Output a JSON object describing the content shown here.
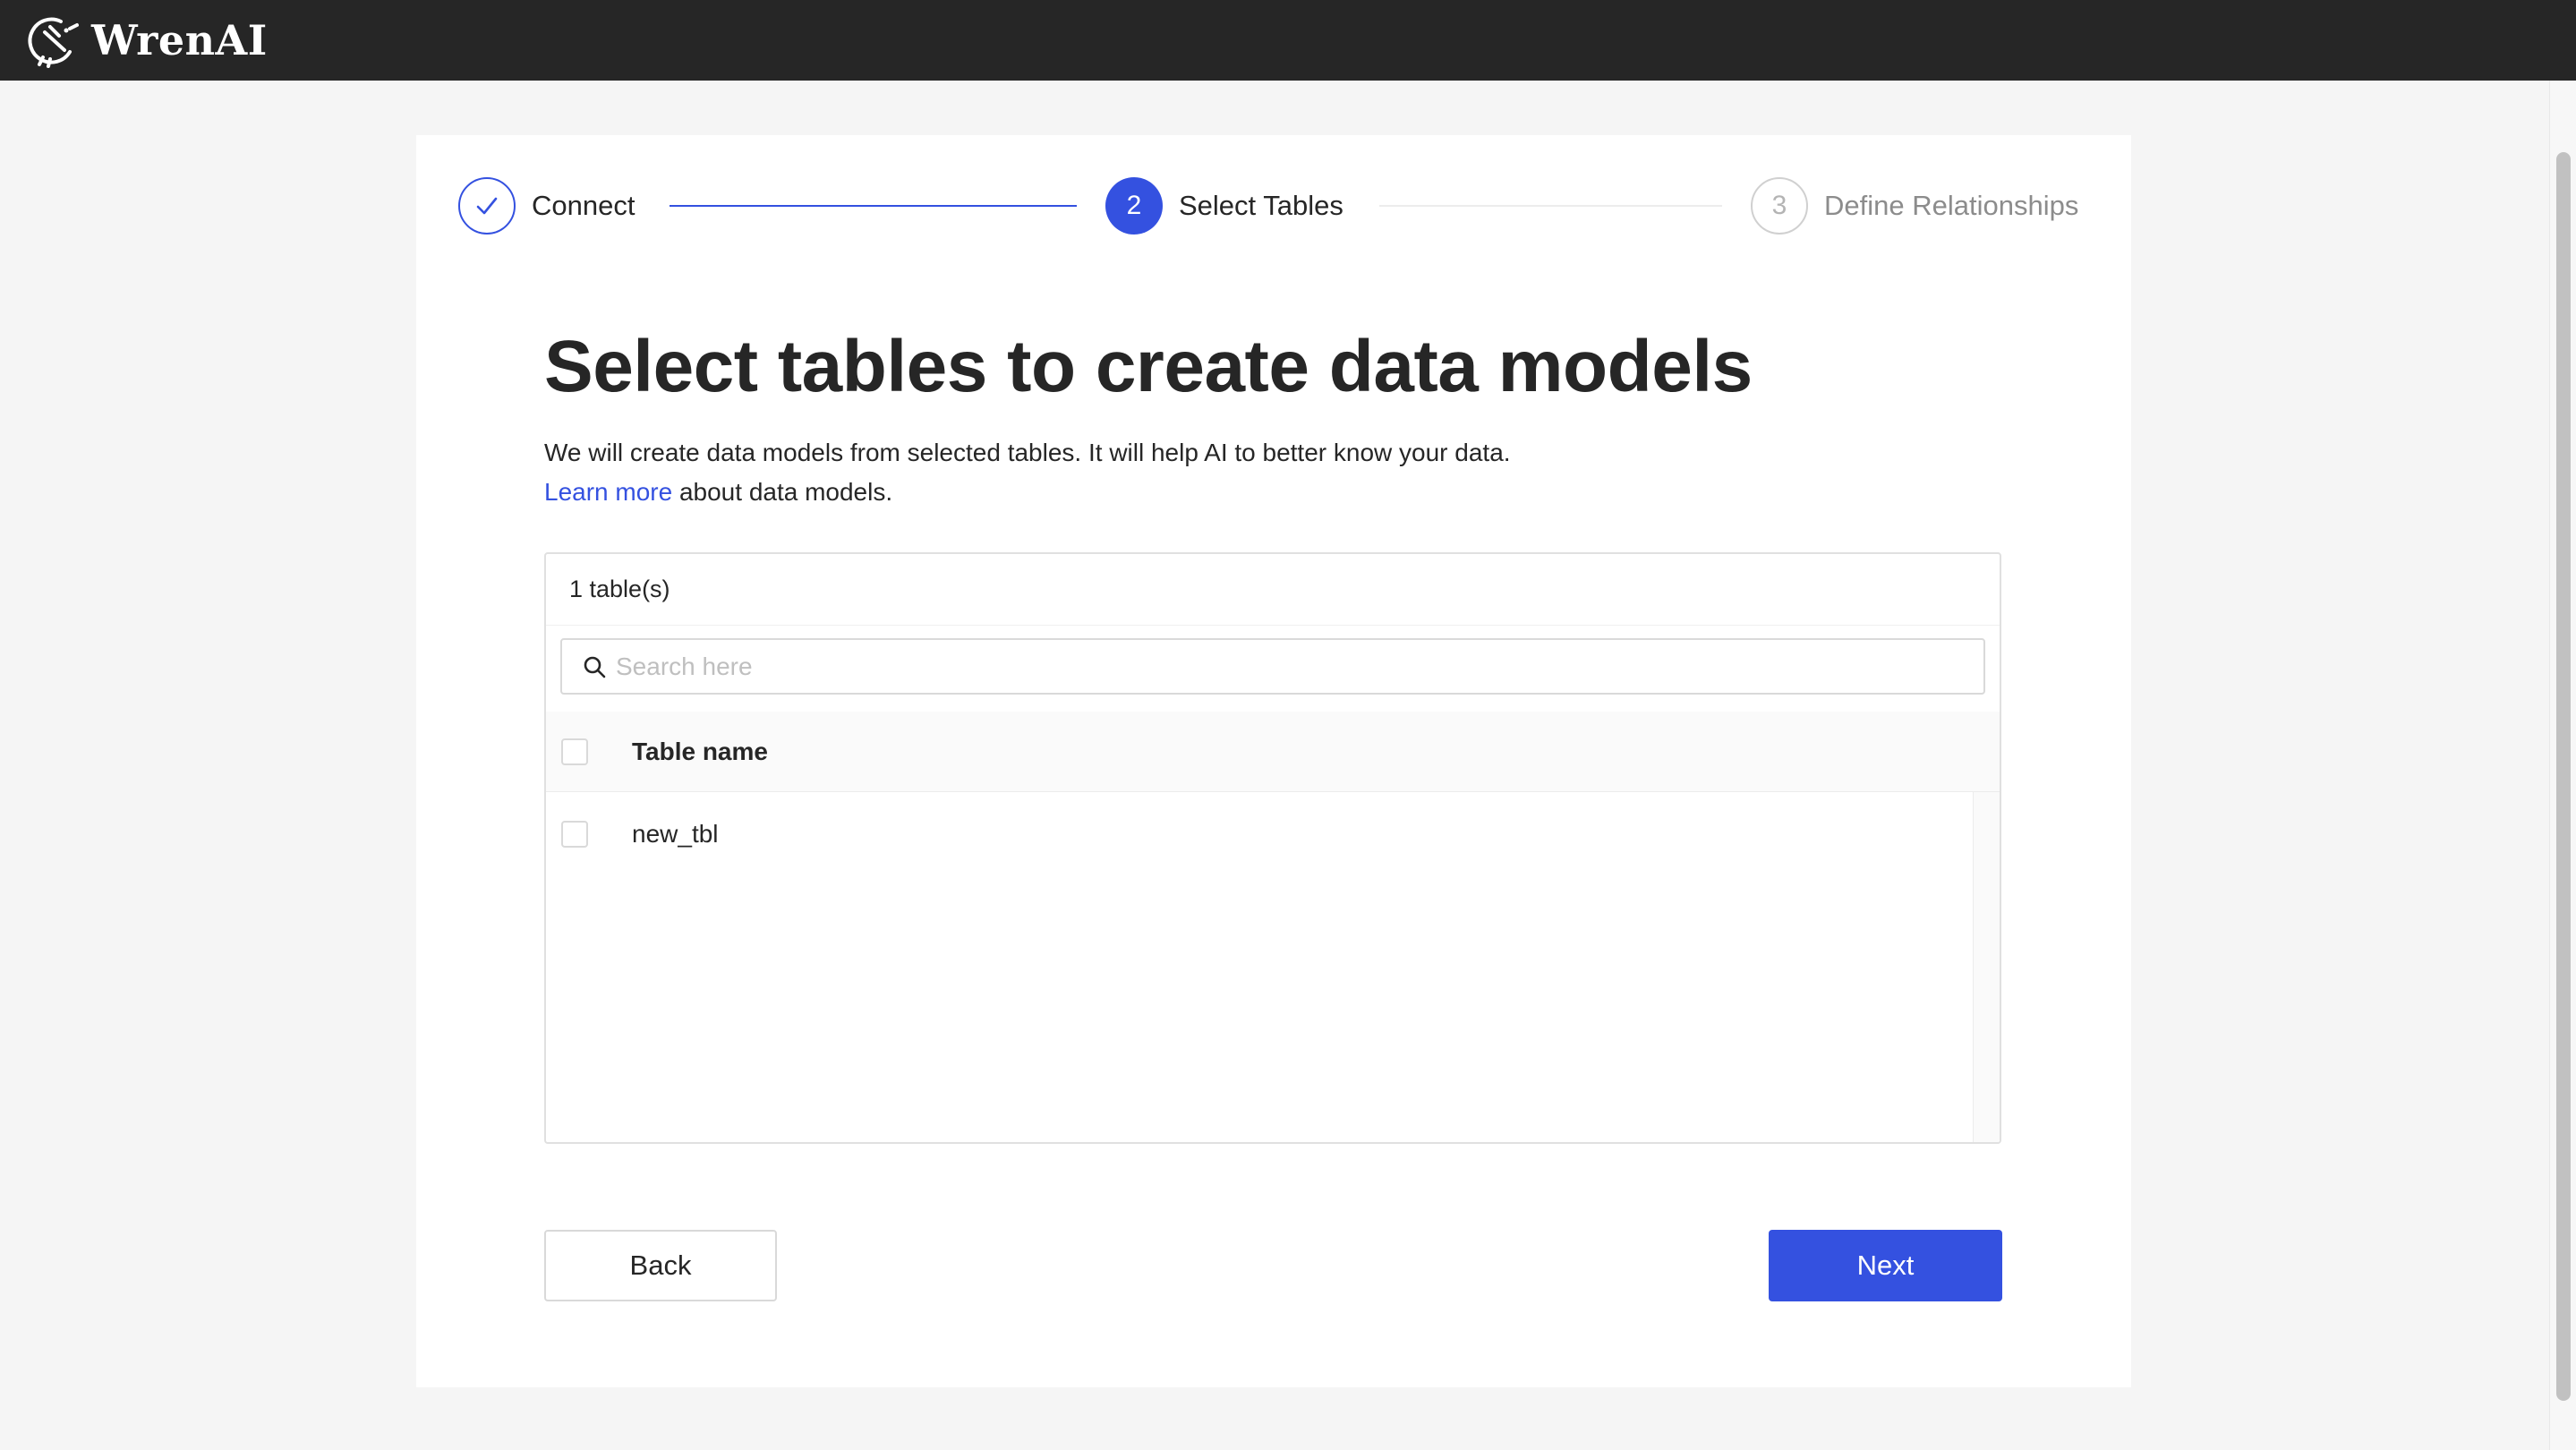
{
  "app": {
    "name": "WrenAI"
  },
  "stepper": {
    "steps": [
      {
        "label": "Connect",
        "number": "1",
        "status": "done"
      },
      {
        "label": "Select Tables",
        "number": "2",
        "status": "active"
      },
      {
        "label": "Define Relationships",
        "number": "3",
        "status": "pending"
      }
    ]
  },
  "main": {
    "title": "Select tables to create data models",
    "description_line1": "We will create data models from selected tables. It will help AI to better know your data.",
    "learn_more_link": "Learn more",
    "description_line2_rest": " about data models."
  },
  "table_panel": {
    "count_label": "1 table(s)",
    "search": {
      "placeholder": "Search here",
      "value": ""
    },
    "column_header": "Table name",
    "rows": [
      {
        "name": "new_tbl",
        "checked": false
      }
    ],
    "select_all_checked": false
  },
  "actions": {
    "back_label": "Back",
    "next_label": "Next"
  },
  "colors": {
    "primary": "#3451e0",
    "header_bg": "#262626",
    "page_bg": "#f5f5f5"
  },
  "icons": {
    "logo": "wren-bird-logo-icon",
    "step_done": "check-icon",
    "search": "search-icon"
  }
}
